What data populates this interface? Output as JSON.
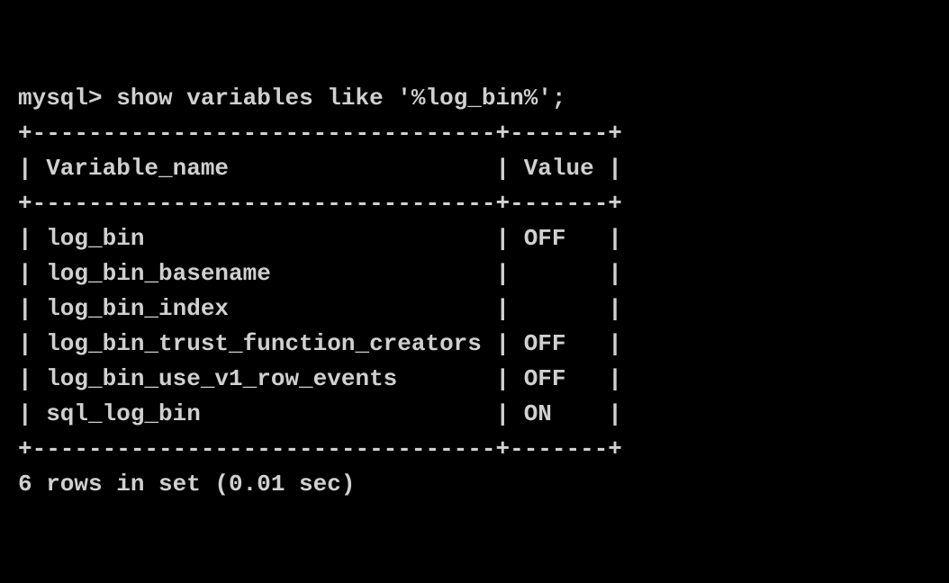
{
  "prompt": "mysql>",
  "command": "show variables like '%log_bin%';",
  "table": {
    "border_top": "+---------------------------------+-------+",
    "border_mid": "+---------------------------------+-------+",
    "border_bottom": "+---------------------------------+-------+",
    "headers": {
      "col1": "Variable_name",
      "col2": "Value"
    },
    "rows": [
      {
        "name": "log_bin",
        "value": "OFF"
      },
      {
        "name": "log_bin_basename",
        "value": ""
      },
      {
        "name": "log_bin_index",
        "value": ""
      },
      {
        "name": "log_bin_trust_function_creators",
        "value": "OFF"
      },
      {
        "name": "log_bin_use_v1_row_events",
        "value": "OFF"
      },
      {
        "name": "sql_log_bin",
        "value": "ON"
      }
    ]
  },
  "footer": "6 rows in set (0.01 sec)",
  "col1_width": 31,
  "col2_width": 5
}
